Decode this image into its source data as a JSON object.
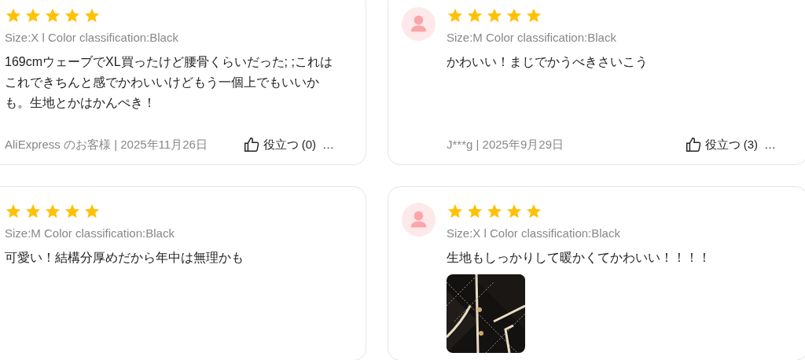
{
  "reviews": [
    {
      "stars": 5,
      "sku": "Size:X l Color classification:Black",
      "text": "169cmウェーブでXL買ったけど腰骨くらいだった; ;これはこれできちんと感でかわいいけどもう一個上でもいいかも。生地とかはかんぺき！",
      "footer": {
        "author_date": "AliExpress のお客様 | 2025年11月26日",
        "helpful": "役立つ (0)",
        "more": "…"
      }
    },
    {
      "avatar": true,
      "stars": 5,
      "sku": "Size:M Color classification:Black",
      "text": "かわいい！まじでかうべきさいこう",
      "footer": {
        "author_date": "J***g | 2025年9月29日",
        "helpful": "役立つ (3)",
        "more": "…"
      }
    },
    {
      "stars": 5,
      "sku": "Size:M Color classification:Black",
      "text": "可愛い！結構分厚めだから年中は無理かも"
    },
    {
      "avatar": true,
      "stars": 5,
      "sku": "Size:X l Color classification:Black",
      "text": "生地もしっかりして暖かくてかわいい！！！！",
      "photos": [
        {
          "kind": "picture"
        }
      ]
    }
  ]
}
